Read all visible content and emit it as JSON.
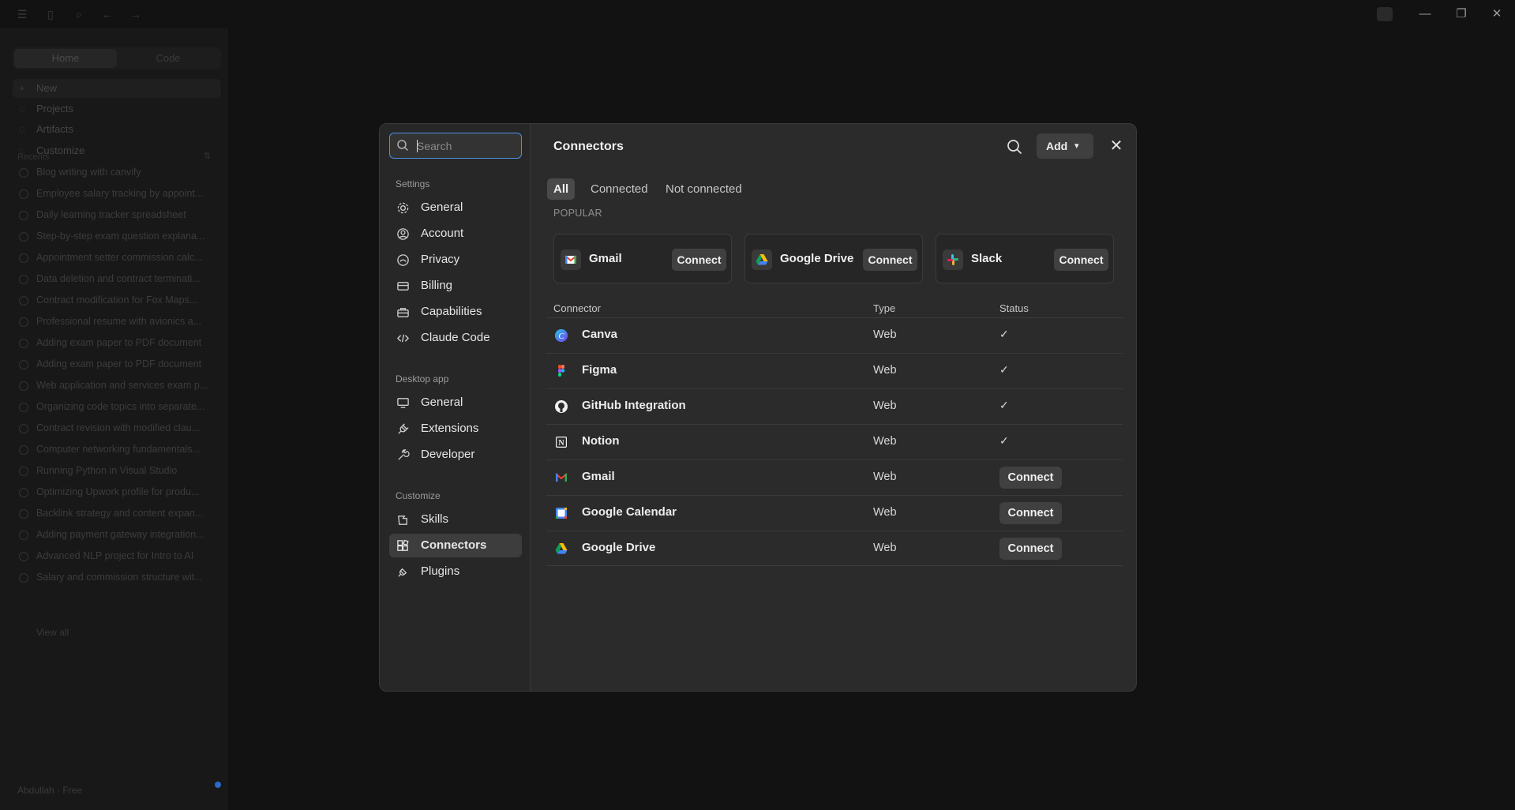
{
  "background": {
    "sidebar_tabs": [
      "Home",
      "Code"
    ],
    "nav": [
      "New",
      "Projects",
      "Artifacts",
      "Customize"
    ],
    "recents_label": "Recents",
    "recents": [
      "Blog writing with canvify",
      "Employee salary tracking by appoint...",
      "Daily learning tracker spreadsheet",
      "Step-by-step exam question explana...",
      "Appointment setter commission calc...",
      "Data deletion and contract terminati...",
      "Contract modification for Fox Maps...",
      "Professional resume with avionics a...",
      "Adding exam paper to PDF document",
      "Adding exam paper to PDF document",
      "Web application and services exam p...",
      "Organizing code topics into separate...",
      "Contract revision with modified clau...",
      "Computer networking fundamentals...",
      "Running Python in Visual Studio",
      "Optimizing Upwork profile for produ...",
      "Backlink strategy and content expan...",
      "Adding payment gateway integration...",
      "Advanced NLP project for Intro to AI",
      "Salary and commission structure wit..."
    ],
    "view_all": "View all",
    "user": "Abdullah · Free"
  },
  "modal": {
    "search_placeholder": "Search",
    "sections": {
      "settings": "Settings",
      "desktop": "Desktop app",
      "customize": "Customize"
    },
    "settings_items": [
      "General",
      "Account",
      "Privacy",
      "Billing",
      "Capabilities",
      "Claude Code"
    ],
    "desktop_items": [
      "General",
      "Extensions",
      "Developer"
    ],
    "customize_items": [
      "Skills",
      "Connectors",
      "Plugins"
    ],
    "active_item": "Connectors",
    "title": "Connectors",
    "add_label": "Add",
    "filters": [
      "All",
      "Connected",
      "Not connected"
    ],
    "active_filter": "All",
    "popular_label": "POPULAR",
    "popular": [
      {
        "name": "Gmail",
        "button": "Connect",
        "icon": "gmail-icon"
      },
      {
        "name": "Google Drive",
        "button": "Connect",
        "icon": "google-drive-icon"
      },
      {
        "name": "Slack",
        "button": "Connect",
        "icon": "slack-icon"
      }
    ],
    "table_headers": {
      "connector": "Connector",
      "type": "Type",
      "status": "Status"
    },
    "connectors": [
      {
        "name": "Canva",
        "type": "Web",
        "status": "connected",
        "check": "✓",
        "icon": "canva-icon"
      },
      {
        "name": "Figma",
        "type": "Web",
        "status": "connected",
        "check": "✓",
        "icon": "figma-icon"
      },
      {
        "name": "GitHub Integration",
        "type": "Web",
        "status": "connected",
        "check": "✓",
        "icon": "github-icon"
      },
      {
        "name": "Notion",
        "type": "Web",
        "status": "connected",
        "check": "✓",
        "icon": "notion-icon"
      },
      {
        "name": "Gmail",
        "type": "Web",
        "status": "not_connected",
        "button": "Connect",
        "icon": "gmail-icon"
      },
      {
        "name": "Google Calendar",
        "type": "Web",
        "status": "not_connected",
        "button": "Connect",
        "icon": "google-calendar-icon"
      },
      {
        "name": "Google Drive",
        "type": "Web",
        "status": "not_connected",
        "button": "Connect",
        "icon": "google-drive-icon"
      }
    ]
  },
  "colors": {
    "accent": "#4e8fe0",
    "modal_bg": "#2b2b2b",
    "app_bg": "#121212"
  }
}
